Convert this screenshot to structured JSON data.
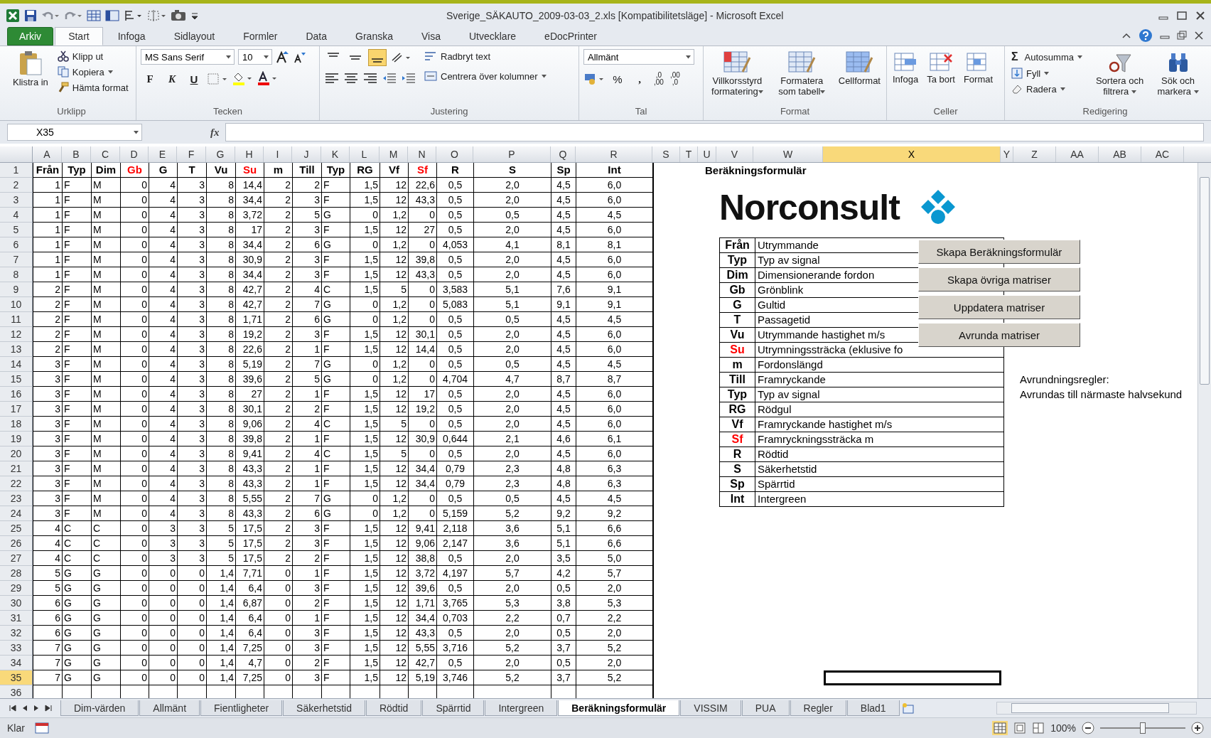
{
  "window": {
    "title": "Sverige_SÄKAUTO_2009-03-03_2.xls  [Kompatibilitetsläge]  -  Microsoft Excel"
  },
  "ribbon_tabs": [
    {
      "label": "Arkiv",
      "kind": "file",
      "selected": false
    },
    {
      "label": "Start",
      "kind": "tab",
      "selected": true
    },
    {
      "label": "Infoga",
      "kind": "tab",
      "selected": false
    },
    {
      "label": "Sidlayout",
      "kind": "tab",
      "selected": false
    },
    {
      "label": "Formler",
      "kind": "tab",
      "selected": false
    },
    {
      "label": "Data",
      "kind": "tab",
      "selected": false
    },
    {
      "label": "Granska",
      "kind": "tab",
      "selected": false
    },
    {
      "label": "Visa",
      "kind": "tab",
      "selected": false
    },
    {
      "label": "Utvecklare",
      "kind": "tab",
      "selected": false
    },
    {
      "label": "eDocPrinter",
      "kind": "tab",
      "selected": false
    }
  ],
  "ribbon": {
    "clipboard": {
      "label": "Urklipp",
      "paste": "Klistra in",
      "cut": "Klipp ut",
      "copy": "Kopiera",
      "format_painter": "Hämta format"
    },
    "font": {
      "label": "Tecken",
      "family": "MS Sans Serif",
      "size": "10",
      "bold": "F",
      "italic": "K",
      "underline": "U"
    },
    "alignment": {
      "label": "Justering",
      "vertical": [
        {
          "selected": false
        },
        {
          "selected": false
        },
        {
          "selected": true
        }
      ],
      "wrap": "Radbryt text",
      "merge": "Centrera över kolumner"
    },
    "number": {
      "label": "Tal",
      "format": "Allmänt",
      "percent": "%",
      "comma": ",",
      "increase": [
        ",0",
        ",00"
      ],
      "decrease": [
        ",00",
        ",0"
      ]
    },
    "styles": {
      "label": "Format",
      "items": [
        "Villkorsstyrd formatering",
        "Formatera som tabell",
        "Cellformat"
      ]
    },
    "cells": {
      "label": "Celler",
      "items": [
        "Infoga",
        "Ta bort",
        "Format"
      ]
    },
    "editing": {
      "label": "Redigering",
      "sigma": "Σ",
      "autosum": "Autosumma",
      "fill": "Fyll",
      "clear": "Radera",
      "sort": "Sortera och filtrera",
      "find": "Sök och markera"
    }
  },
  "formula_bar": {
    "name_box": "X35",
    "fx": "fx"
  },
  "column_headers": [
    {
      "label": "A",
      "selected": false
    },
    {
      "label": "B",
      "selected": false
    },
    {
      "label": "C",
      "selected": false
    },
    {
      "label": "D",
      "selected": false
    },
    {
      "label": "E",
      "selected": false
    },
    {
      "label": "F",
      "selected": false
    },
    {
      "label": "G",
      "selected": false
    },
    {
      "label": "H",
      "selected": false
    },
    {
      "label": "I",
      "selected": false
    },
    {
      "label": "J",
      "selected": false
    },
    {
      "label": "K",
      "selected": false
    },
    {
      "label": "L",
      "selected": false
    },
    {
      "label": "M",
      "selected": false
    },
    {
      "label": "N",
      "selected": false
    },
    {
      "label": "O",
      "selected": false
    },
    {
      "label": "P",
      "selected": false
    },
    {
      "label": "Q",
      "selected": false
    },
    {
      "label": "R",
      "selected": false
    },
    {
      "label": "S",
      "selected": false
    },
    {
      "label": "T",
      "selected": false
    },
    {
      "label": "U",
      "selected": false
    },
    {
      "label": "V",
      "selected": false
    },
    {
      "label": "W",
      "selected": false
    },
    {
      "label": "X",
      "selected": true
    },
    {
      "label": "Y",
      "selected": false
    },
    {
      "label": "Z",
      "selected": false
    },
    {
      "label": "AA",
      "selected": false
    },
    {
      "label": "AB",
      "selected": false
    },
    {
      "label": "AC",
      "selected": false
    }
  ],
  "row_headers": [
    {
      "label": "1",
      "selected": false
    },
    {
      "label": "2",
      "selected": false
    },
    {
      "label": "3",
      "selected": false
    },
    {
      "label": "4",
      "selected": false
    },
    {
      "label": "5",
      "selected": false
    },
    {
      "label": "6",
      "selected": false
    },
    {
      "label": "7",
      "selected": false
    },
    {
      "label": "8",
      "selected": false
    },
    {
      "label": "9",
      "selected": false
    },
    {
      "label": "10",
      "selected": false
    },
    {
      "label": "11",
      "selected": false
    },
    {
      "label": "12",
      "selected": false
    },
    {
      "label": "13",
      "selected": false
    },
    {
      "label": "14",
      "selected": false
    },
    {
      "label": "15",
      "selected": false
    },
    {
      "label": "16",
      "selected": false
    },
    {
      "label": "17",
      "selected": false
    },
    {
      "label": "18",
      "selected": false
    },
    {
      "label": "19",
      "selected": false
    },
    {
      "label": "20",
      "selected": false
    },
    {
      "label": "21",
      "selected": false
    },
    {
      "label": "22",
      "selected": false
    },
    {
      "label": "23",
      "selected": false
    },
    {
      "label": "24",
      "selected": false
    },
    {
      "label": "25",
      "selected": false
    },
    {
      "label": "26",
      "selected": false
    },
    {
      "label": "27",
      "selected": false
    },
    {
      "label": "28",
      "selected": false
    },
    {
      "label": "29",
      "selected": false
    },
    {
      "label": "30",
      "selected": false
    },
    {
      "label": "31",
      "selected": false
    },
    {
      "label": "32",
      "selected": false
    },
    {
      "label": "33",
      "selected": false
    },
    {
      "label": "34",
      "selected": false
    },
    {
      "label": "35",
      "selected": true
    },
    {
      "label": "36",
      "selected": false
    }
  ],
  "table": {
    "columns": [
      {
        "text": "Från",
        "color": "#000000"
      },
      {
        "text": "Typ",
        "color": "#000000"
      },
      {
        "text": "Dim",
        "color": "#000000"
      },
      {
        "text": "Gb",
        "color": "#ff0000"
      },
      {
        "text": "G",
        "color": "#000000"
      },
      {
        "text": "T",
        "color": "#000000"
      },
      {
        "text": "Vu",
        "color": "#000000"
      },
      {
        "text": "Su",
        "color": "#ff0000"
      },
      {
        "text": "m",
        "color": "#000000"
      },
      {
        "text": "Till",
        "color": "#000000"
      },
      {
        "text": "Typ",
        "color": "#000000"
      },
      {
        "text": "RG",
        "color": "#000000"
      },
      {
        "text": "Vf",
        "color": "#000000"
      },
      {
        "text": "Sf",
        "color": "#ff0000"
      },
      {
        "text": "R",
        "color": "#000000"
      },
      {
        "text": "S",
        "color": "#000000"
      },
      {
        "text": "Sp",
        "color": "#000000"
      },
      {
        "text": "Int",
        "color": "#000000"
      }
    ],
    "rows": [
      [
        "1",
        "F",
        "M",
        "0",
        "4",
        "3",
        "8",
        "14,4",
        "2",
        "2",
        "F",
        "1,5",
        "12",
        "22,6",
        "0,5",
        "2,0",
        "4,5",
        "6,0"
      ],
      [
        "1",
        "F",
        "M",
        "0",
        "4",
        "3",
        "8",
        "34,4",
        "2",
        "3",
        "F",
        "1,5",
        "12",
        "43,3",
        "0,5",
        "2,0",
        "4,5",
        "6,0"
      ],
      [
        "1",
        "F",
        "M",
        "0",
        "4",
        "3",
        "8",
        "3,72",
        "2",
        "5",
        "G",
        "0",
        "1,2",
        "0",
        "0,5",
        "0,5",
        "4,5",
        "4,5"
      ],
      [
        "1",
        "F",
        "M",
        "0",
        "4",
        "3",
        "8",
        "17",
        "2",
        "3",
        "F",
        "1,5",
        "12",
        "27",
        "0,5",
        "2,0",
        "4,5",
        "6,0"
      ],
      [
        "1",
        "F",
        "M",
        "0",
        "4",
        "3",
        "8",
        "34,4",
        "2",
        "6",
        "G",
        "0",
        "1,2",
        "0",
        "4,053",
        "4,1",
        "8,1",
        "8,1"
      ],
      [
        "1",
        "F",
        "M",
        "0",
        "4",
        "3",
        "8",
        "30,9",
        "2",
        "3",
        "F",
        "1,5",
        "12",
        "39,8",
        "0,5",
        "2,0",
        "4,5",
        "6,0"
      ],
      [
        "1",
        "F",
        "M",
        "0",
        "4",
        "3",
        "8",
        "34,4",
        "2",
        "3",
        "F",
        "1,5",
        "12",
        "43,3",
        "0,5",
        "2,0",
        "4,5",
        "6,0"
      ],
      [
        "2",
        "F",
        "M",
        "0",
        "4",
        "3",
        "8",
        "42,7",
        "2",
        "4",
        "C",
        "1,5",
        "5",
        "0",
        "3,583",
        "5,1",
        "7,6",
        "9,1"
      ],
      [
        "2",
        "F",
        "M",
        "0",
        "4",
        "3",
        "8",
        "42,7",
        "2",
        "7",
        "G",
        "0",
        "1,2",
        "0",
        "5,083",
        "5,1",
        "9,1",
        "9,1"
      ],
      [
        "2",
        "F",
        "M",
        "0",
        "4",
        "3",
        "8",
        "1,71",
        "2",
        "6",
        "G",
        "0",
        "1,2",
        "0",
        "0,5",
        "0,5",
        "4,5",
        "4,5"
      ],
      [
        "2",
        "F",
        "M",
        "0",
        "4",
        "3",
        "8",
        "19,2",
        "2",
        "3",
        "F",
        "1,5",
        "12",
        "30,1",
        "0,5",
        "2,0",
        "4,5",
        "6,0"
      ],
      [
        "2",
        "F",
        "M",
        "0",
        "4",
        "3",
        "8",
        "22,6",
        "2",
        "1",
        "F",
        "1,5",
        "12",
        "14,4",
        "0,5",
        "2,0",
        "4,5",
        "6,0"
      ],
      [
        "3",
        "F",
        "M",
        "0",
        "4",
        "3",
        "8",
        "5,19",
        "2",
        "7",
        "G",
        "0",
        "1,2",
        "0",
        "0,5",
        "0,5",
        "4,5",
        "4,5"
      ],
      [
        "3",
        "F",
        "M",
        "0",
        "4",
        "3",
        "8",
        "39,6",
        "2",
        "5",
        "G",
        "0",
        "1,2",
        "0",
        "4,704",
        "4,7",
        "8,7",
        "8,7"
      ],
      [
        "3",
        "F",
        "M",
        "0",
        "4",
        "3",
        "8",
        "27",
        "2",
        "1",
        "F",
        "1,5",
        "12",
        "17",
        "0,5",
        "2,0",
        "4,5",
        "6,0"
      ],
      [
        "3",
        "F",
        "M",
        "0",
        "4",
        "3",
        "8",
        "30,1",
        "2",
        "2",
        "F",
        "1,5",
        "12",
        "19,2",
        "0,5",
        "2,0",
        "4,5",
        "6,0"
      ],
      [
        "3",
        "F",
        "M",
        "0",
        "4",
        "3",
        "8",
        "9,06",
        "2",
        "4",
        "C",
        "1,5",
        "5",
        "0",
        "0,5",
        "2,0",
        "4,5",
        "6,0"
      ],
      [
        "3",
        "F",
        "M",
        "0",
        "4",
        "3",
        "8",
        "39,8",
        "2",
        "1",
        "F",
        "1,5",
        "12",
        "30,9",
        "0,644",
        "2,1",
        "4,6",
        "6,1"
      ],
      [
        "3",
        "F",
        "M",
        "0",
        "4",
        "3",
        "8",
        "9,41",
        "2",
        "4",
        "C",
        "1,5",
        "5",
        "0",
        "0,5",
        "2,0",
        "4,5",
        "6,0"
      ],
      [
        "3",
        "F",
        "M",
        "0",
        "4",
        "3",
        "8",
        "43,3",
        "2",
        "1",
        "F",
        "1,5",
        "12",
        "34,4",
        "0,79",
        "2,3",
        "4,8",
        "6,3"
      ],
      [
        "3",
        "F",
        "M",
        "0",
        "4",
        "3",
        "8",
        "43,3",
        "2",
        "1",
        "F",
        "1,5",
        "12",
        "34,4",
        "0,79",
        "2,3",
        "4,8",
        "6,3"
      ],
      [
        "3",
        "F",
        "M",
        "0",
        "4",
        "3",
        "8",
        "5,55",
        "2",
        "7",
        "G",
        "0",
        "1,2",
        "0",
        "0,5",
        "0,5",
        "4,5",
        "4,5"
      ],
      [
        "3",
        "F",
        "M",
        "0",
        "4",
        "3",
        "8",
        "43,3",
        "2",
        "6",
        "G",
        "0",
        "1,2",
        "0",
        "5,159",
        "5,2",
        "9,2",
        "9,2"
      ],
      [
        "4",
        "C",
        "C",
        "0",
        "3",
        "3",
        "5",
        "17,5",
        "2",
        "3",
        "F",
        "1,5",
        "12",
        "9,41",
        "2,118",
        "3,6",
        "5,1",
        "6,6"
      ],
      [
        "4",
        "C",
        "C",
        "0",
        "3",
        "3",
        "5",
        "17,5",
        "2",
        "3",
        "F",
        "1,5",
        "12",
        "9,06",
        "2,147",
        "3,6",
        "5,1",
        "6,6"
      ],
      [
        "4",
        "C",
        "C",
        "0",
        "3",
        "3",
        "5",
        "17,5",
        "2",
        "2",
        "F",
        "1,5",
        "12",
        "38,8",
        "0,5",
        "2,0",
        "3,5",
        "5,0"
      ],
      [
        "5",
        "G",
        "G",
        "0",
        "0",
        "0",
        "1,4",
        "7,71",
        "0",
        "1",
        "F",
        "1,5",
        "12",
        "3,72",
        "4,197",
        "5,7",
        "4,2",
        "5,7"
      ],
      [
        "5",
        "G",
        "G",
        "0",
        "0",
        "0",
        "1,4",
        "6,4",
        "0",
        "3",
        "F",
        "1,5",
        "12",
        "39,6",
        "0,5",
        "2,0",
        "0,5",
        "2,0"
      ],
      [
        "6",
        "G",
        "G",
        "0",
        "0",
        "0",
        "1,4",
        "6,87",
        "0",
        "2",
        "F",
        "1,5",
        "12",
        "1,71",
        "3,765",
        "5,3",
        "3,8",
        "5,3"
      ],
      [
        "6",
        "G",
        "G",
        "0",
        "0",
        "0",
        "1,4",
        "6,4",
        "0",
        "1",
        "F",
        "1,5",
        "12",
        "34,4",
        "0,703",
        "2,2",
        "0,7",
        "2,2"
      ],
      [
        "6",
        "G",
        "G",
        "0",
        "0",
        "0",
        "1,4",
        "6,4",
        "0",
        "3",
        "F",
        "1,5",
        "12",
        "43,3",
        "0,5",
        "2,0",
        "0,5",
        "2,0"
      ],
      [
        "7",
        "G",
        "G",
        "0",
        "0",
        "0",
        "1,4",
        "7,25",
        "0",
        "3",
        "F",
        "1,5",
        "12",
        "5,55",
        "3,716",
        "5,2",
        "3,7",
        "5,2"
      ],
      [
        "7",
        "G",
        "G",
        "0",
        "0",
        "0",
        "1,4",
        "4,7",
        "0",
        "2",
        "F",
        "1,5",
        "12",
        "42,7",
        "0,5",
        "2,0",
        "0,5",
        "2,0"
      ],
      [
        "7",
        "G",
        "G",
        "0",
        "0",
        "0",
        "1,4",
        "7,25",
        "0",
        "3",
        "F",
        "1,5",
        "12",
        "5,19",
        "3,746",
        "5,2",
        "3,7",
        "5,2"
      ]
    ]
  },
  "form": {
    "title": "Beräkningsformulär",
    "logo": "Norconsult",
    "legend": [
      {
        "key": "Från",
        "description": "Utrymmande",
        "color": "#000000"
      },
      {
        "key": "Typ",
        "description": "Typ av signal",
        "color": "#000000"
      },
      {
        "key": "Dim",
        "description": "Dimensionerande fordon",
        "color": "#000000"
      },
      {
        "key": "Gb",
        "description": "Grönblink",
        "color": "#000000"
      },
      {
        "key": "G",
        "description": "Gultid",
        "color": "#000000"
      },
      {
        "key": "T",
        "description": "Passagetid",
        "color": "#000000"
      },
      {
        "key": "Vu",
        "description": "Utrymmande hastighet m/s",
        "color": "#000000"
      },
      {
        "key": "Su",
        "description": "Utrymningssträcka (eklusive fo",
        "color": "#ff0000"
      },
      {
        "key": "m",
        "description": "Fordonslängd",
        "color": "#000000"
      },
      {
        "key": "Till",
        "description": "Framryckande",
        "color": "#000000"
      },
      {
        "key": "Typ",
        "description": "Typ av signal",
        "color": "#000000"
      },
      {
        "key": "RG",
        "description": "Rödgul",
        "color": "#000000"
      },
      {
        "key": "Vf",
        "description": "Framryckande hastighet m/s",
        "color": "#000000"
      },
      {
        "key": "Sf",
        "description": "Framryckningssträcka m",
        "color": "#ff0000"
      },
      {
        "key": "R",
        "description": "Rödtid",
        "color": "#000000"
      },
      {
        "key": "S",
        "description": "Säkerhetstid",
        "color": "#000000"
      },
      {
        "key": "Sp",
        "description": "Spärrtid",
        "color": "#000000"
      },
      {
        "key": "Int",
        "description": "Intergreen",
        "color": "#000000"
      }
    ],
    "buttons": [
      "Skapa Beräkningsformulär",
      "Skapa övriga matriser",
      "Uppdatera  matriser",
      "Avrunda  matriser"
    ],
    "notes": [
      "Avrundningsregler:",
      "Avrundas till närmaste halvsekund"
    ]
  },
  "sheet_tabs": [
    {
      "label": "Dim-värden",
      "selected": false
    },
    {
      "label": "Allmänt",
      "selected": false
    },
    {
      "label": "Fientligheter",
      "selected": false
    },
    {
      "label": "Säkerhetstid",
      "selected": false
    },
    {
      "label": "Rödtid",
      "selected": false
    },
    {
      "label": "Spärrtid",
      "selected": false
    },
    {
      "label": "Intergreen",
      "selected": false
    },
    {
      "label": "Beräkningsformulär",
      "selected": true
    },
    {
      "label": "VISSIM",
      "selected": false
    },
    {
      "label": "PUA",
      "selected": false
    },
    {
      "label": "Regler",
      "selected": false
    },
    {
      "label": "Blad1",
      "selected": false
    }
  ],
  "status_bar": {
    "status": "Klar",
    "zoom": "100%",
    "zoom_slider": {
      "level": 0.5
    }
  }
}
